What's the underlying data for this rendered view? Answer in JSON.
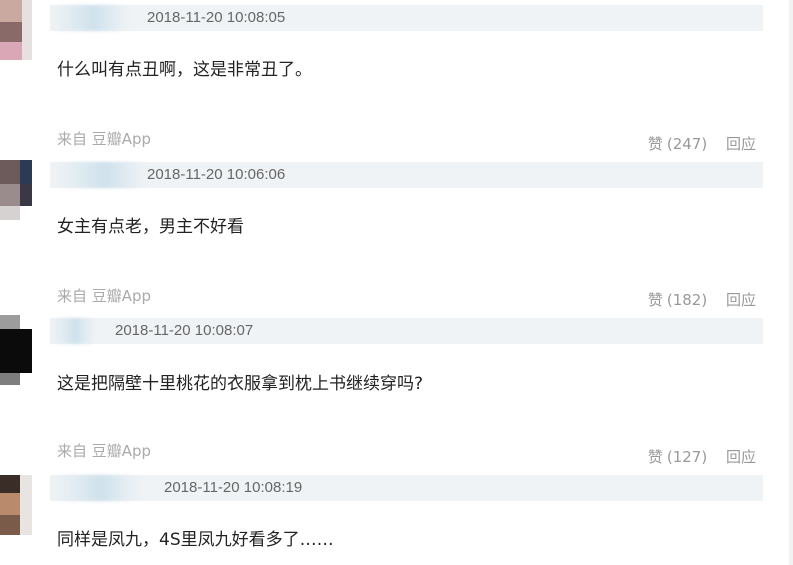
{
  "comments": [
    {
      "timestamp": "2018-11-20 10:08:05",
      "text": "什么叫有点丑啊，这是非常丑了。",
      "source": "来自 豆瓣App",
      "like_label": "赞",
      "like_count": "(247)",
      "reply_label": "回应"
    },
    {
      "timestamp": "2018-11-20 10:06:06",
      "text": "女主有点老，男主不好看",
      "source": "来自 豆瓣App",
      "like_label": "赞",
      "like_count": "(182)",
      "reply_label": "回应"
    },
    {
      "timestamp": "2018-11-20 10:08:07",
      "text": "这是把隔壁十里桃花的衣服拿到枕上书继续穿吗?",
      "source": "来自 豆瓣App",
      "like_label": "赞",
      "like_count": "(127)",
      "reply_label": "回应"
    },
    {
      "timestamp": "2018-11-20 10:08:19",
      "text": "同样是凤九，4S里凤九好看多了……"
    }
  ]
}
